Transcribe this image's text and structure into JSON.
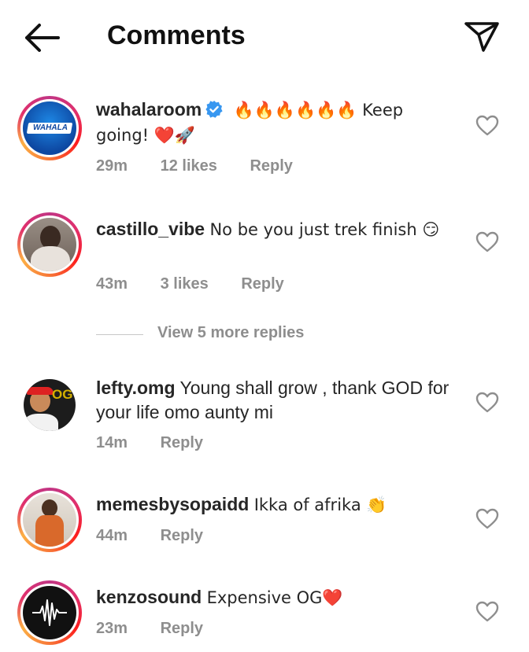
{
  "header": {
    "title": "Comments",
    "back_icon": "arrow-left-icon",
    "share_icon": "paper-plane-icon"
  },
  "comments": [
    {
      "username": "wahalaroom",
      "verified": true,
      "text": "🔥🔥🔥🔥🔥🔥 Keep going! ❤️🚀",
      "time": "29m",
      "likes": "12 likes",
      "reply": "Reply",
      "avatar_text": "WAHALA"
    },
    {
      "username": "castillo_vibe",
      "verified": false,
      "text": "No be you just trek finish 😏",
      "time": "43m",
      "likes": "3 likes",
      "reply": "Reply"
    },
    {
      "username": "lefty.omg",
      "verified": false,
      "text": "Young shall grow , thank GOD for your life omo aunty mi",
      "time": "14m",
      "reply": "Reply",
      "avatar_text": "OG"
    },
    {
      "username": "memesbysopaidd",
      "verified": false,
      "text": "Ikka of afrika 👏",
      "time": "44m",
      "reply": "Reply"
    },
    {
      "username": "kenzosound",
      "verified": false,
      "text": "Expensive OG❤️",
      "time": "23m",
      "reply": "Reply"
    }
  ],
  "view_more": "View 5 more replies",
  "colors": {
    "text": "#262626",
    "muted": "#8e8e8e",
    "verified": "#3897f0",
    "ring_start": "#c13584",
    "ring_end": "#fcaf45"
  }
}
